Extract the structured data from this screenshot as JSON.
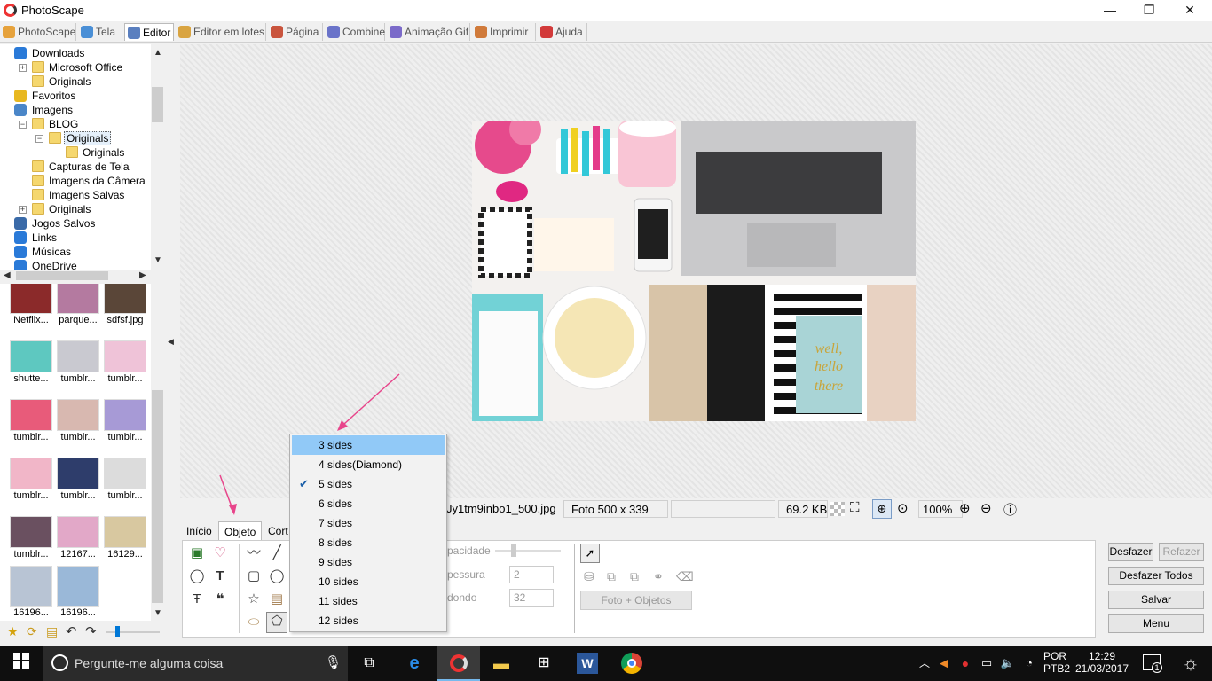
{
  "window": {
    "title": "PhotoScape",
    "minimize": "—",
    "restore": "❐",
    "close": "✕"
  },
  "main_tabs": [
    {
      "label": "PhotoScape",
      "icon": "photoscape-icon",
      "color": "#e6a23c"
    },
    {
      "label": "Tela",
      "icon": "screen-icon",
      "color": "#4a8fd6"
    },
    {
      "label": "Editor",
      "icon": "editor-icon",
      "color": "#5a7fbf"
    },
    {
      "label": "Editor em lotes",
      "icon": "batch-editor-icon",
      "color": "#d9a441"
    },
    {
      "label": "Página",
      "icon": "page-icon",
      "color": "#c9543d"
    },
    {
      "label": "Combine",
      "icon": "combine-icon",
      "color": "#6a73c9"
    },
    {
      "label": "Animação Gif",
      "icon": "gif-icon",
      "color": "#7b6ac9"
    },
    {
      "label": "Imprimir",
      "icon": "print-icon",
      "color": "#d07a3a"
    },
    {
      "label": "Ajuda",
      "icon": "help-icon",
      "color": "#d23a3a"
    }
  ],
  "tree": [
    {
      "label": "Downloads",
      "indent": 0,
      "icon": "download-icon",
      "expander": "",
      "selected": false
    },
    {
      "label": "Microsoft Office",
      "indent": 1,
      "icon": "folder-icon",
      "expander": "+",
      "selected": false
    },
    {
      "label": "Originals",
      "indent": 1,
      "icon": "folder-icon",
      "expander": "",
      "selected": false
    },
    {
      "label": "Favoritos",
      "indent": 0,
      "icon": "star-icon",
      "expander": "",
      "selected": false
    },
    {
      "label": "Imagens",
      "indent": 0,
      "icon": "pictures-icon",
      "expander": "",
      "selected": false
    },
    {
      "label": "BLOG",
      "indent": 1,
      "icon": "folder-icon",
      "expander": "−",
      "selected": false
    },
    {
      "label": "Originals",
      "indent": 2,
      "icon": "folder-icon",
      "expander": "−",
      "selected": true
    },
    {
      "label": "Originals",
      "indent": 3,
      "icon": "folder-icon",
      "expander": "",
      "selected": false
    },
    {
      "label": "Capturas de Tela",
      "indent": 1,
      "icon": "folder-icon",
      "expander": "",
      "selected": false
    },
    {
      "label": "Imagens da Câmera",
      "indent": 1,
      "icon": "folder-icon",
      "expander": "",
      "selected": false
    },
    {
      "label": "Imagens Salvas",
      "indent": 1,
      "icon": "folder-icon",
      "expander": "",
      "selected": false
    },
    {
      "label": "Originals",
      "indent": 1,
      "icon": "folder-icon",
      "expander": "+",
      "selected": false
    },
    {
      "label": "Jogos Salvos",
      "indent": 0,
      "icon": "games-icon",
      "expander": "",
      "selected": false
    },
    {
      "label": "Links",
      "indent": 0,
      "icon": "links-icon",
      "expander": "",
      "selected": false
    },
    {
      "label": "Músicas",
      "indent": 0,
      "icon": "music-icon",
      "expander": "",
      "selected": false
    },
    {
      "label": "OneDrive",
      "indent": 0,
      "icon": "onedrive-icon",
      "expander": "",
      "selected": false
    }
  ],
  "thumbnails": [
    {
      "label": "Netflix...",
      "color": "#8b2a2a"
    },
    {
      "label": "parque...",
      "color": "#b47aa0"
    },
    {
      "label": "sdfsf.jpg",
      "color": "#5a4638"
    },
    {
      "label": "shutte...",
      "color": "#5ec8c0"
    },
    {
      "label": "tumblr...",
      "color": "#c9c9d0"
    },
    {
      "label": "tumblr...",
      "color": "#efc3d8"
    },
    {
      "label": "tumblr...",
      "color": "#e85b7a"
    },
    {
      "label": "tumblr...",
      "color": "#d8b8b0"
    },
    {
      "label": "tumblr...",
      "color": "#a79ad6"
    },
    {
      "label": "tumblr...",
      "color": "#f1b6c8"
    },
    {
      "label": "tumblr...",
      "color": "#2e3d6b"
    },
    {
      "label": "tumblr...",
      "color": "#dcdcdc"
    },
    {
      "label": "tumblr...",
      "color": "#6a5060"
    },
    {
      "label": "12167...",
      "color": "#e2a8c8"
    },
    {
      "label": "16129...",
      "color": "#d8c8a0"
    },
    {
      "label": "16196...",
      "color": "#b8c4d4"
    },
    {
      "label": "16196...",
      "color": "#9ab8d8"
    }
  ],
  "status": {
    "filename": "Jy1tm9inbo1_500.jpg",
    "dimensions": "Foto 500 x 339",
    "filesize": "69.2 KB",
    "zoom": "100%"
  },
  "subtabs": [
    "Início",
    "Objeto",
    "Cort"
  ],
  "object_panel": {
    "opacity_label": "pacidade",
    "thickness_label": "pessura",
    "thickness_value": "2",
    "round_label": "dondo",
    "round_value": "32",
    "photo_objects_button": "Foto + Objetos"
  },
  "side_buttons": {
    "undo": "Desfazer",
    "redo": "Refazer",
    "undo_all": "Desfazer Todos",
    "save": "Salvar",
    "menu": "Menu"
  },
  "sides_menu": {
    "items": [
      "3 sides",
      "4 sides(Diamond)",
      "5 sides",
      "6 sides",
      "7 sides",
      "8 sides",
      "9 sides",
      "10 sides",
      "11 sides",
      "12 sides"
    ],
    "highlighted": "3 sides",
    "checked": "5 sides"
  },
  "photo": {
    "handwriting": "well, hello there"
  },
  "taskbar": {
    "search_placeholder": "Pergunte-me alguma coisa",
    "lang": "POR",
    "layout": "PTB2",
    "time": "12:29",
    "date": "21/03/2017",
    "notification_count": "1"
  },
  "colors": {
    "accent": "#0078d7",
    "menu_highlight": "#91c9f7",
    "arrow": "#e8458b"
  }
}
